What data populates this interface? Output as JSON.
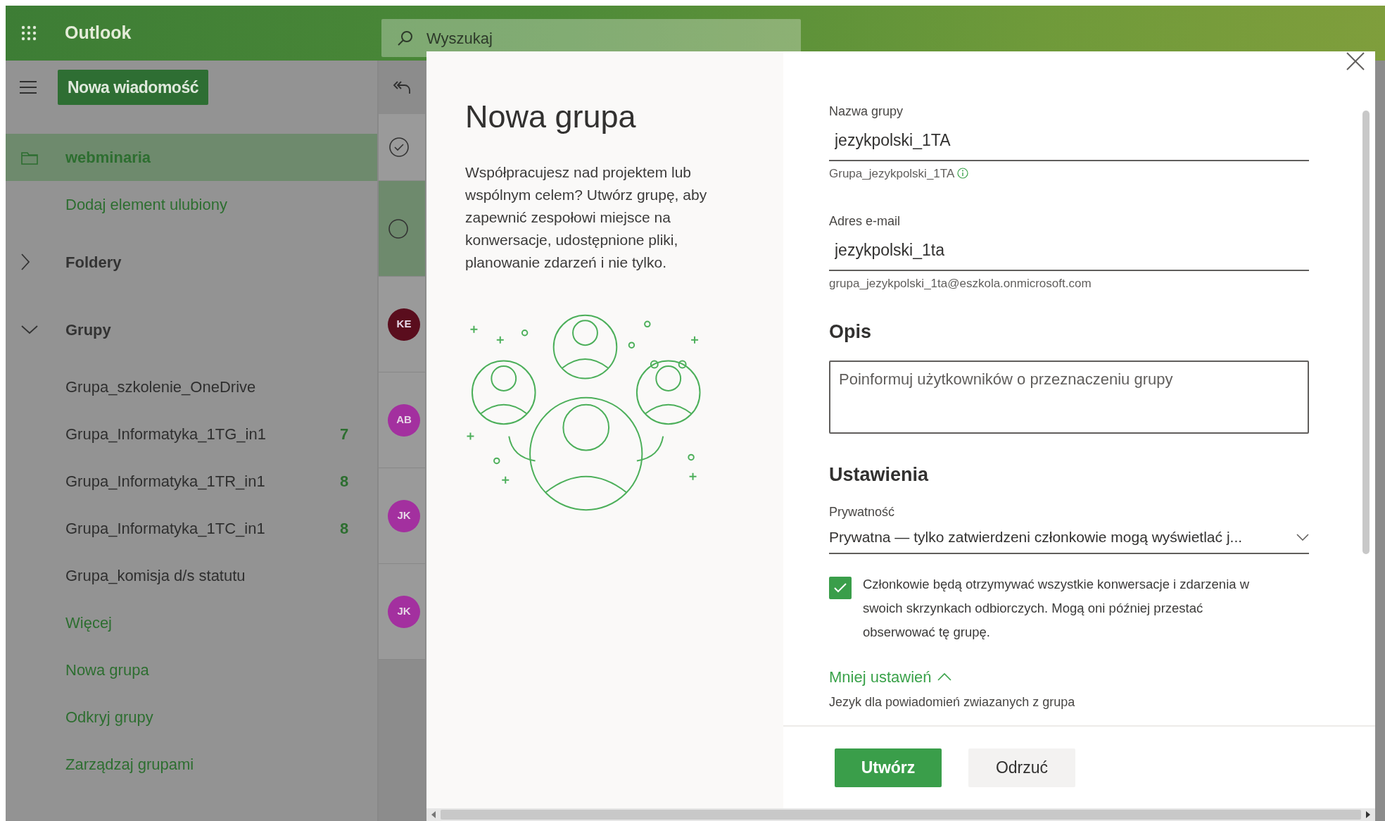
{
  "header": {
    "app_name": "Outlook",
    "search_placeholder": "Wyszukaj"
  },
  "toolbar": {
    "new_message": "Nowa wiadomość"
  },
  "nav": [
    {
      "kind": "folder",
      "label": "webminaria",
      "selected": true
    },
    {
      "kind": "link",
      "label": "Dodaj element ulubiony",
      "selected": false
    },
    {
      "kind": "section",
      "label": "Foldery",
      "expanded": false,
      "selected": false
    },
    {
      "kind": "section",
      "label": "Grupy",
      "expanded": true,
      "selected": false
    },
    {
      "kind": "group",
      "label": "Grupa_szkolenie_OneDrive",
      "selected": false
    },
    {
      "kind": "group",
      "label": "Grupa_Informatyka_1TG_in1",
      "count": "7",
      "selected": false
    },
    {
      "kind": "group",
      "label": "Grupa_Informatyka_1TR_in1",
      "count": "8",
      "selected": false
    },
    {
      "kind": "group",
      "label": "Grupa_Informatyka_1TC_in1",
      "count": "8",
      "selected": false
    },
    {
      "kind": "group",
      "label": "Grupa_komisja d/s statutu",
      "selected": false
    },
    {
      "kind": "link",
      "label": "Więcej",
      "selected": false
    },
    {
      "kind": "link",
      "label": "Nowa grupa",
      "selected": false
    },
    {
      "kind": "link",
      "label": "Odkryj grupy",
      "selected": false
    },
    {
      "kind": "link",
      "label": "Zarządzaj grupami",
      "selected": false
    }
  ],
  "message_list": {
    "rows": [
      {
        "selected": true
      },
      {
        "initials": "KE",
        "color": "#5a0d1d",
        "selected": false
      },
      {
        "initials": "AB",
        "color": "#a3309f",
        "selected": false
      },
      {
        "initials": "JK",
        "color": "#a3309f",
        "selected": false
      },
      {
        "initials": "JK",
        "color": "#a3309f",
        "selected": false
      }
    ]
  },
  "dialog": {
    "title": "Nowa grupa",
    "description": "Współpracujesz nad projektem lub wspólnym celem? Utwórz grupę, aby zapewnić zespołowi miejsce na konwersacje, udostępnione pliki, planowanie zdarzeń i nie tylko.",
    "fields": [
      {
        "label": "Nazwa grupy",
        "value": "jezykpolski_1TA",
        "hint": "Grupa_jezykpolski_1TA",
        "info": true
      },
      {
        "label": "Adres e-mail",
        "value": "jezykpolski_1ta",
        "hint": "grupa_jezykpolski_1ta@eszkola.onmicrosoft.com",
        "info": false
      }
    ],
    "description_heading": "Opis",
    "description_placeholder": "Poinformuj użytkowników o przeznaczeniu grupy",
    "settings_heading": "Ustawienia",
    "privacy": {
      "label": "Prywatność",
      "value": "Prywatna — tylko zatwierdzeni członkowie mogą wyświetlać j..."
    },
    "follow": {
      "checked": true,
      "text": "Członkowie będą otrzymywać wszystkie konwersacje i zdarzenia w swoich skrzynkach odbiorczych. Mogą oni później przestać obserwować tę grupę."
    },
    "less_settings": "Mniej ustawień",
    "language_label": "Jezyk dla powiadomień zwiazanych z grupa",
    "buttons": [
      {
        "label": "Utwórz",
        "kind": "primary"
      },
      {
        "label": "Odrzuć",
        "kind": "secondary"
      }
    ]
  }
}
